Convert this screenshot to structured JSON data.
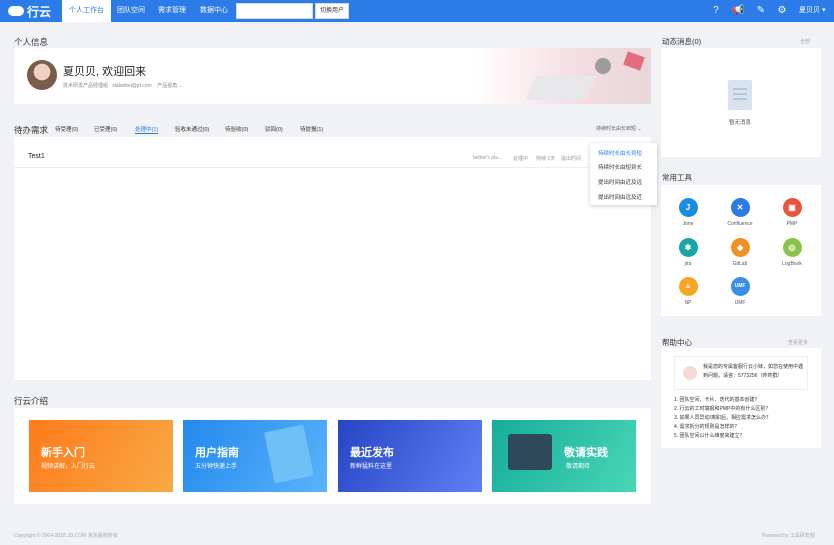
{
  "app": {
    "logo_text": "行云"
  },
  "nav": {
    "tabs": [
      "个人工作台",
      "团队空间",
      "需求管理",
      "数据中心"
    ],
    "search_placeholder": "",
    "switch_button": "切换用户",
    "user_name": "夏贝贝"
  },
  "personal": {
    "section_title": "个人信息",
    "welcome": "夏贝贝, 欢迎回来",
    "dept": "技术研发产品经理组",
    "email": "xiabeibei@jd.com",
    "role": "产品视角"
  },
  "pending": {
    "section_title": "待办需求",
    "tabs": [
      "待受理(0)",
      "已受理(0)",
      "处理中(1)",
      "验收未通过(0)",
      "待验收(0)",
      "驳回(0)",
      "待提报(1)"
    ],
    "sort_label": "持续时长由长到短",
    "tasks": [
      {
        "title": "Test1",
        "meta": [
          "beibei's pla...",
          "处理中",
          "持续 1天",
          "提出时间"
        ]
      }
    ]
  },
  "sort_dropdown": {
    "items": [
      "持续时长由长到短",
      "持续时长由短到长",
      "提出时间由近及远",
      "提出时间由远及近"
    ]
  },
  "intro": {
    "section_title": "行云介绍",
    "cards": [
      {
        "title": "新手入门",
        "sub": "视频讲解，入门行云",
        "color_from": "#ff8a1c",
        "color_to": "#f6b14a"
      },
      {
        "title": "用户指南",
        "sub": "五分钟快速上手",
        "color_from": "#2b8df0",
        "color_to": "#57b3fb"
      },
      {
        "title": "最近发布",
        "sub": "新鲜猛料在这里",
        "color_from": "#2949c9",
        "color_to": "#5a7cf2"
      },
      {
        "title": "敬请实践",
        "sub": "敬请期待",
        "color_from": "#20b6a3",
        "color_to": "#43d3b4"
      }
    ]
  },
  "messages": {
    "title": "动态消息(0)",
    "link": "全部",
    "empty": "暂无消息"
  },
  "tools": {
    "title": "常用工具",
    "items": [
      {
        "label": "Jone",
        "icon": "jone-icon",
        "color": "#1b8ce0",
        "glyph": "J"
      },
      {
        "label": "Confluence",
        "icon": "confluence-icon",
        "color": "#2c7be5",
        "glyph": "✕"
      },
      {
        "label": "PMP",
        "icon": "pmp-icon",
        "color": "#e8543f",
        "glyph": "▣"
      },
      {
        "label": "jira",
        "icon": "jira-icon",
        "color": "#1aa6a4",
        "glyph": "✱"
      },
      {
        "label": "GitLab",
        "icon": "gitlab-icon",
        "color": "#f09126",
        "glyph": "◆"
      },
      {
        "label": "LogBook",
        "icon": "logbook-icon",
        "color": "#8bc34a",
        "glyph": "◎"
      },
      {
        "label": "NP",
        "icon": "np-icon",
        "color": "#f5a623",
        "glyph": "≡"
      },
      {
        "label": "UMF",
        "icon": "umf-icon",
        "color": "#3a8ee6",
        "glyph": "UMF"
      }
    ]
  },
  "help": {
    "title": "帮助中心",
    "more": "查看更多",
    "intro": "我是您的专属客服行云小妹，如您在使用中遇到问题，请咨：5773256（咚咚群）",
    "faqs": [
      "1.  团队空间、卡片、迭代的基本创建？",
      "2.  行云的工时填报和PMP中的有什么区别？",
      "3.  如果人员异动/离职后，相应需求怎么办？",
      "4.  需求拆分的规则是怎样的？",
      "5.  团队空间以什么维度来建立？"
    ]
  },
  "footer": {
    "copyright": "Copyright © 2004-2018 JD.COM 京东版权所有",
    "powered": "Powered by 工具研发部"
  }
}
